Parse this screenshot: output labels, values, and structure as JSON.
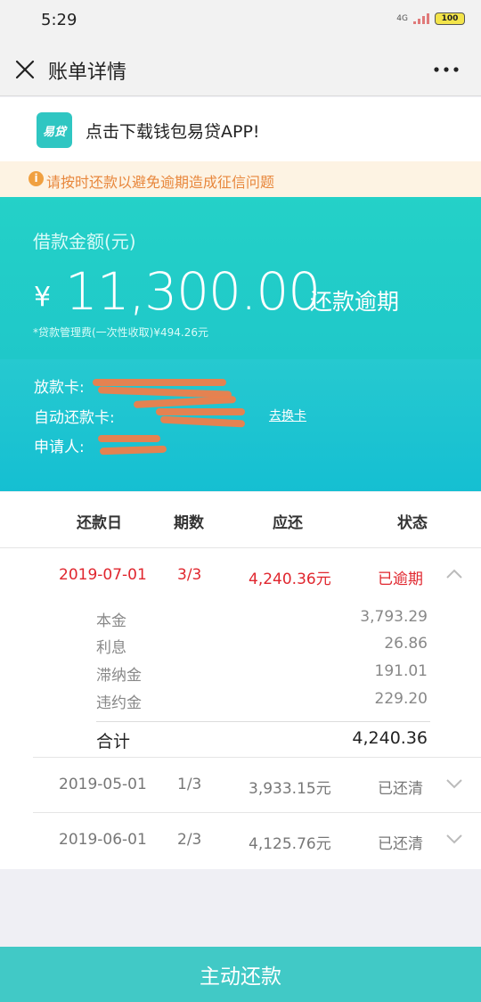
{
  "status_bar": {
    "time": "5:29",
    "network": "4G",
    "battery": "100"
  },
  "nav": {
    "title": "账单详情"
  },
  "banner": {
    "logo_text": "易贷",
    "text": "点击下载钱包易贷APP!"
  },
  "warning": {
    "text": "请按时还款以避免逾期造成征信问题"
  },
  "loan": {
    "amount_label": "借款金额(元)",
    "currency": "¥",
    "amount": "11,300.00",
    "status": "还款逾期",
    "fee_note": "*贷款管理费(一次性收取)¥494.26元"
  },
  "cards": {
    "loan_card_label": "放款卡:",
    "auto_card_label": "自动还款卡:",
    "change_card": "去换卡",
    "applicant_label": "申请人:"
  },
  "table": {
    "headers": {
      "date": "还款日",
      "period": "期数",
      "due": "应还",
      "status": "状态"
    },
    "rows": [
      {
        "date": "2019-07-01",
        "period": "3/3",
        "amount": "4,240.36元",
        "status": "已逾期",
        "details": [
          {
            "label": "本金",
            "value": "3,793.29"
          },
          {
            "label": "利息",
            "value": "26.86"
          },
          {
            "label": "滞纳金",
            "value": "191.01"
          },
          {
            "label": "违约金",
            "value": "229.20"
          }
        ],
        "total_label": "合计",
        "total": "4,240.36"
      },
      {
        "date": "2019-05-01",
        "period": "1/3",
        "amount": "3,933.15元",
        "status": "已还清"
      },
      {
        "date": "2019-06-01",
        "period": "2/3",
        "amount": "4,125.76元",
        "status": "已还清"
      }
    ]
  },
  "button": {
    "repay": "主动还款"
  },
  "colors": {
    "accent": "#1fc8c9",
    "overdue": "#e0262e",
    "warning": "#e8873c",
    "button": "#41c9c6"
  }
}
